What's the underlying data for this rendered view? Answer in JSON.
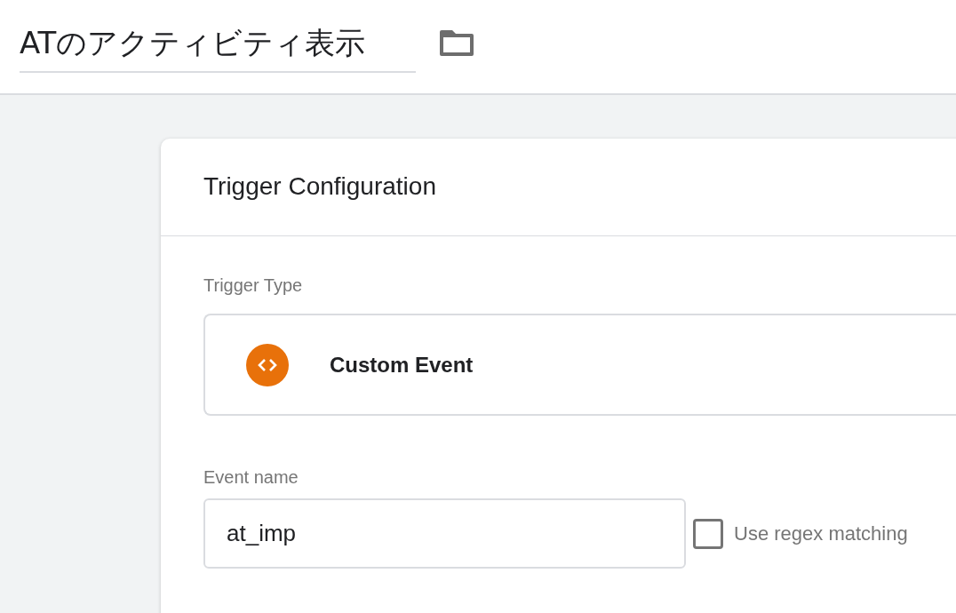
{
  "header": {
    "title": "ATのアクティビティ表示"
  },
  "card": {
    "title": "Trigger Configuration",
    "trigger_type": {
      "label": "Trigger Type",
      "name": "Custom Event"
    },
    "event_name": {
      "label": "Event name",
      "value": "at_imp"
    },
    "regex": {
      "label": "Use regex matching",
      "checked": false
    }
  }
}
